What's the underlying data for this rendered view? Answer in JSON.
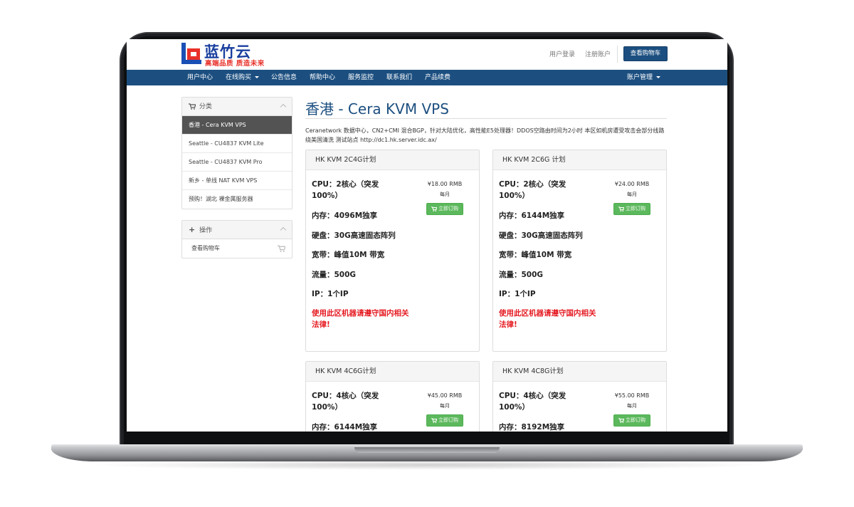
{
  "brand": {
    "name": "蓝竹云",
    "tagline": "高端品质 质造未来"
  },
  "header": {
    "login": "用户登录",
    "register": "注册账户",
    "cart_button": "查看购物车"
  },
  "nav": {
    "items": [
      {
        "label": "用户中心"
      },
      {
        "label": "在线购买"
      },
      {
        "label": "公告信息"
      },
      {
        "label": "帮助中心"
      },
      {
        "label": "服务监控"
      },
      {
        "label": "联系我们"
      },
      {
        "label": "产品续费"
      }
    ],
    "account": "账户管理"
  },
  "sidebar": {
    "category_title": "分类",
    "categories": [
      {
        "label": "香港 - Cera KVM VPS",
        "active": true
      },
      {
        "label": "Seattle - CU4837 KVM Lite"
      },
      {
        "label": "Seattle - CU4837 KVM Pro"
      },
      {
        "label": "新乡 - 单线 NAT KVM VPS"
      },
      {
        "label": "预购！湖北 裸金属服务器"
      }
    ],
    "actions_title": "操作",
    "actions": [
      {
        "label": "查看购物车"
      }
    ]
  },
  "main": {
    "title": "香港 - Cera KVM VPS",
    "description": "Ceranetwork 数据中心，CN2+CMI 混合BGP，针对大陆优化，高性能E5处理器！DDOS空路由时间为2小时 本区如机房遭受攻击会部分线路绕美国清洗 测试站点 http://dc1.hk.server.idc.ax/"
  },
  "plans": [
    {
      "name": "HK KVM 2C4G计划",
      "cpu": "CPU：2核心（突发100%）",
      "ram": "内存：4096M独享",
      "disk": "硬盘：30G高速固态阵列",
      "bandwidth": "宽带：峰值10M 带宽",
      "traffic": "流量：500G",
      "ip": "IP：1个IP",
      "warning": "使用此区机器请遵守国内相关法律!",
      "price": "¥18.00 RMB",
      "period": "每月",
      "order": "立即订购"
    },
    {
      "name": "HK KVM 2C6G 计划",
      "cpu": "CPU：2核心（突发100%）",
      "ram": "内存：6144M独享",
      "disk": "硬盘：30G高速固态阵列",
      "bandwidth": "宽带：峰值10M 带宽",
      "traffic": "流量：500G",
      "ip": "IP：1个IP",
      "warning": "使用此区机器请遵守国内相关法律!",
      "price": "¥24.00 RMB",
      "period": "每月",
      "order": "立即订购"
    },
    {
      "name": "HK KVM 4C6G计划",
      "cpu": "CPU：4核心（突发100%）",
      "ram": "内存：6144M独享",
      "price": "¥45.00 RMB",
      "period": "每月",
      "order": "立即订购"
    },
    {
      "name": "HK KVM 4C8G计划",
      "cpu": "CPU：4核心（突发100%）",
      "ram": "内存：8192M独享",
      "price": "¥55.00 RMB",
      "period": "每月",
      "order": "立即订购"
    }
  ],
  "icons": {
    "cart": "shopping-cart-icon",
    "plus": "plus-icon",
    "chevron": "chevron-up-icon",
    "caret": "caret-down-icon"
  },
  "colors": {
    "nav": "#1c4f80",
    "order_button": "#5cb85c",
    "warning": "#e51c23",
    "active_item": "#535353"
  }
}
